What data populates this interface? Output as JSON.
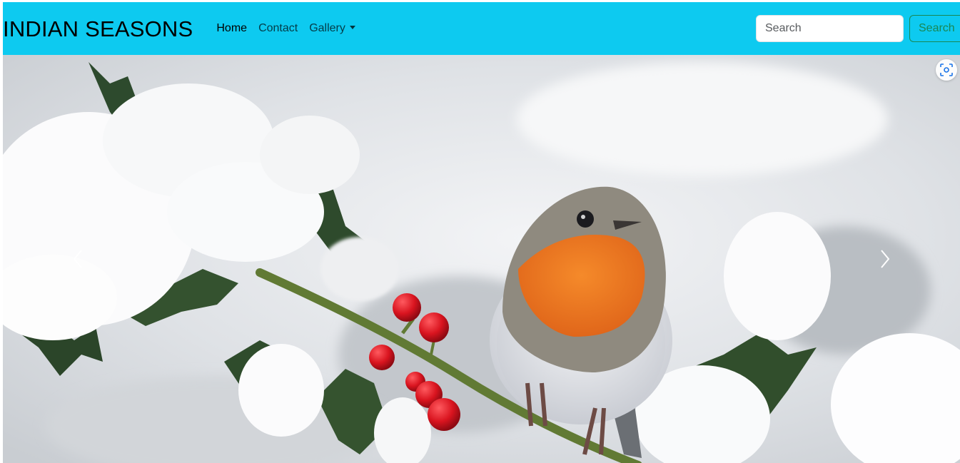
{
  "navbar": {
    "brand": "INDIAN SEASONS",
    "links": [
      {
        "label": "Home",
        "active": true
      },
      {
        "label": "Contact",
        "active": false
      },
      {
        "label": "Gallery",
        "active": false,
        "dropdown": true
      }
    ],
    "search": {
      "placeholder": "Search",
      "button_label": "Search"
    }
  },
  "carousel": {
    "image_subject": "robin-on-snowy-holly-branch",
    "controls": {
      "prev_icon": "chevron-left-icon",
      "next_icon": "chevron-right-icon"
    },
    "overlay_button_icon": "visual-search-icon"
  },
  "colors": {
    "navbar_bg": "#0dcaf0",
    "search_button": "#198754"
  }
}
